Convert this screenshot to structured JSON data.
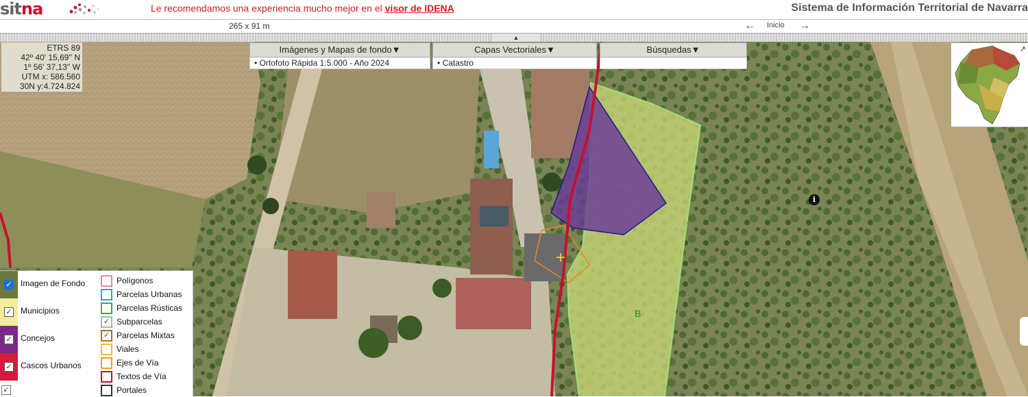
{
  "header": {
    "logo_part1": "sit",
    "logo_part2": "na",
    "promo_text": "Le recomendamos una experiencia mucho mejor en el ",
    "promo_link": "visor de IDENA",
    "system_title": "Sistema de Información Territorial de Navarra"
  },
  "toolbar": {
    "scale": "265 x 91 m",
    "back_icon": "←",
    "home_label": "Inicio",
    "forward_icon": "→",
    "toggle_icon": "▲"
  },
  "coordinates": {
    "system": "ETRS 89",
    "lat": "42º 40' 15,69'' N",
    "lon": "1º 56' 37,13'' W",
    "utm_x": "UTM x:   586.560",
    "utm_y": "30N  y:4.724.824"
  },
  "menus": [
    {
      "label": "Imágenes y Mapas de fondo▼",
      "value": "• Ortofoto Rápida 1:5.000 - Año 2024"
    },
    {
      "label": "Capas Vectoriales▼",
      "value": "• Catastro"
    },
    {
      "label": "Búsquedas▼",
      "value": ""
    }
  ],
  "map": {
    "parcel_label": "B",
    "info_icon": "i",
    "minimap_expand": "↗"
  },
  "legend": {
    "main_layers": [
      {
        "label": "Imagen de Fondo",
        "checked": true,
        "color": "#6b7a3a"
      },
      {
        "label": "Municipios",
        "checked": true,
        "color": "#f3ee9a"
      },
      {
        "label": "Concejos",
        "checked": true,
        "color": "#7a2a86"
      },
      {
        "label": "Cascos Urbanos",
        "checked": true,
        "color": "#d41c3c"
      }
    ],
    "cadastre_layers": [
      {
        "label": "Polígonos",
        "checked": false,
        "color": "#e58b9a"
      },
      {
        "label": "Parcelas Urbanas",
        "checked": false,
        "color": "#3aa0d8"
      },
      {
        "label": "Parcelas Rústicas",
        "checked": false,
        "color": "#2fb34a"
      },
      {
        "label": "Subparcelas",
        "checked": true,
        "color": "#b0b0b0"
      },
      {
        "label": "Parcelas Mixtas",
        "checked": true,
        "color": "#b06a2a"
      },
      {
        "label": "Viales",
        "checked": false,
        "color": "#e8c21a"
      },
      {
        "label": "Ejes de Vía",
        "checked": false,
        "color": "#e8a21a"
      },
      {
        "label": "Textos de Vía",
        "checked": false,
        "color": "#b01c2c"
      },
      {
        "label": "Portales",
        "checked": false,
        "color": "#333333"
      }
    ],
    "check_mark": "✓",
    "collapse_icon": "↙"
  }
}
